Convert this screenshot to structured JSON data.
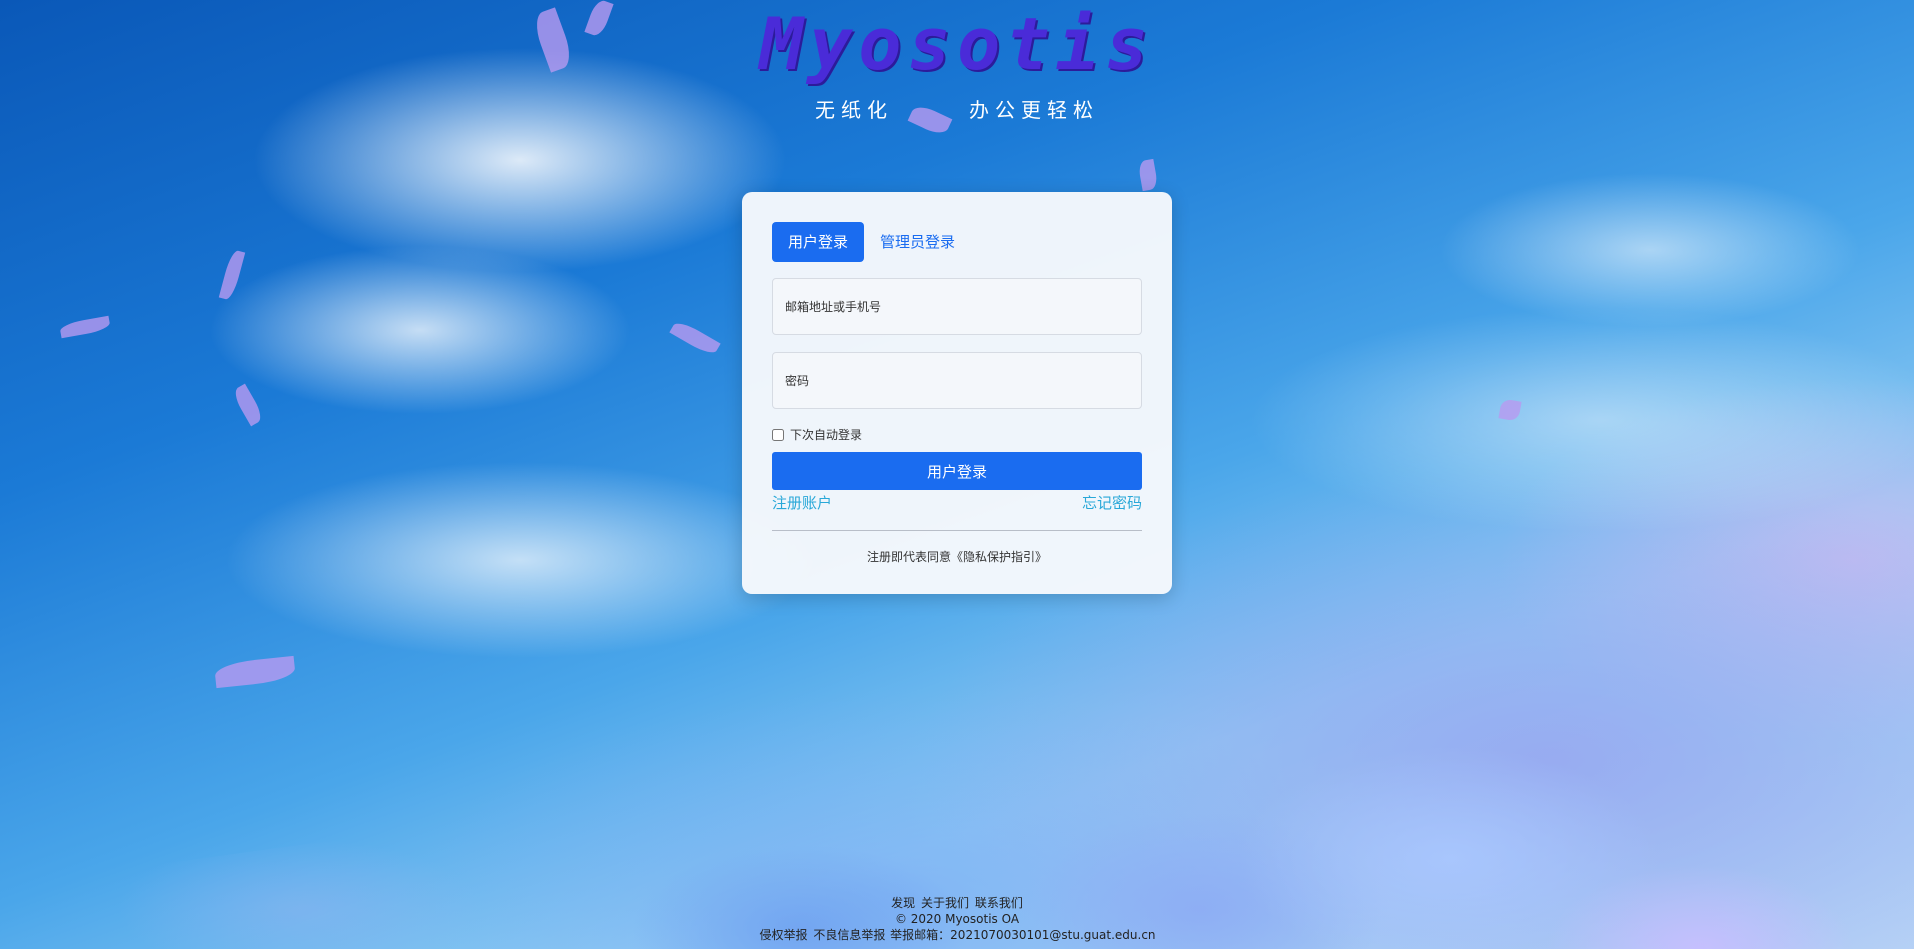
{
  "brand": {
    "title": "Myosotis",
    "slogan_left": "无纸化",
    "slogan_right": "办公更轻松"
  },
  "login": {
    "tabs": [
      {
        "label": "用户登录",
        "active": true
      },
      {
        "label": "管理员登录",
        "active": false
      }
    ],
    "account_placeholder": "邮箱地址或手机号",
    "account_value": "",
    "password_placeholder": "密码",
    "password_value": "",
    "remember_label": "下次自动登录",
    "remember_checked": false,
    "submit_label": "用户登录",
    "register_label": "注册账户",
    "forgot_label": "忘记密码",
    "agreement_prefix": "注册即代表同意",
    "agreement_link": "《隐私保护指引》"
  },
  "footer": {
    "links": [
      "发现",
      "关于我们",
      "联系我们"
    ],
    "copyright": "© 2020 Myosotis OA",
    "report_1": "侵权举报",
    "report_2": "不良信息举报",
    "report_email_label": "举报邮箱：",
    "report_email": "2021070030101@stu.guat.edu.cn"
  },
  "colors": {
    "accent": "#1a6cf0",
    "link": "#29a8d8",
    "brand_title": "#4a2bd8"
  }
}
